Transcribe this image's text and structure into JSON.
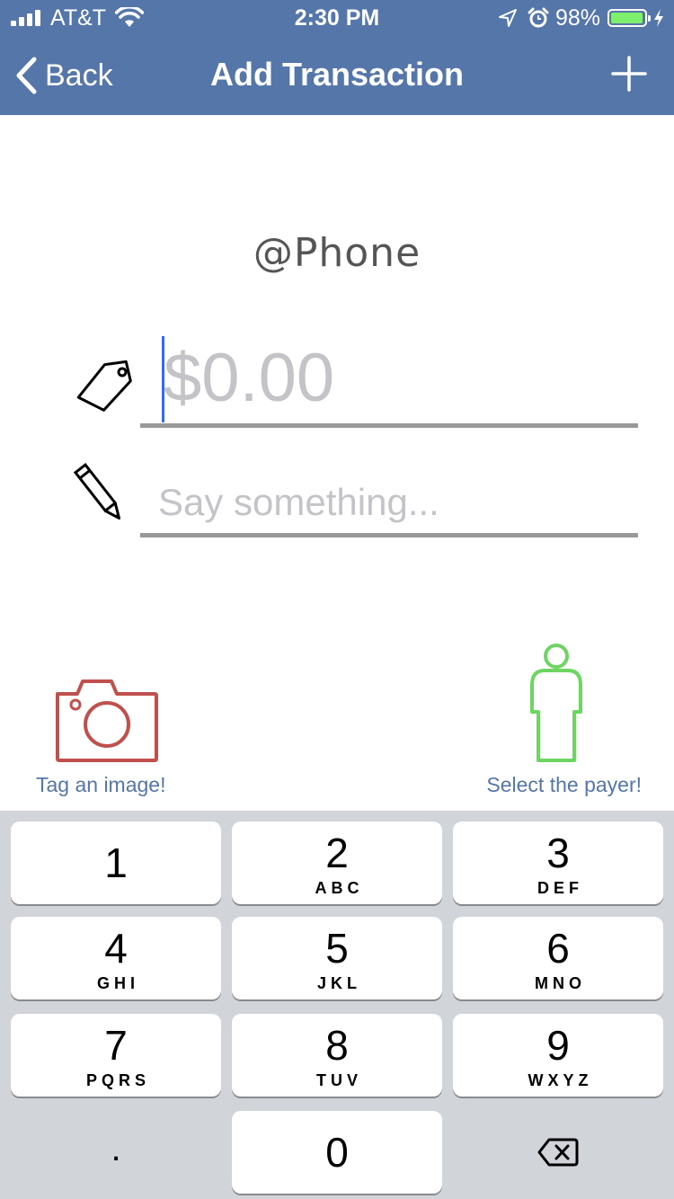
{
  "status_bar": {
    "carrier": "AT&T",
    "time": "2:30 PM",
    "battery": "98%",
    "battery_level": 0.98,
    "icons": [
      "signal-bars-icon",
      "wifi-icon",
      "location-arrow-icon",
      "alarm-icon",
      "battery-icon",
      "charging-bolt-icon"
    ]
  },
  "nav": {
    "back_label": "Back",
    "title": "Add Transaction",
    "add_icon": "plus-icon"
  },
  "main": {
    "title": "@Phone",
    "amount_placeholder": "$0.00",
    "amount_value": "",
    "note_placeholder": "Say something...",
    "note_value": "",
    "tag_image_label": "Tag an image!",
    "select_payer_label": "Select the payer!"
  },
  "colors": {
    "nav_bar": "#5476a9",
    "link": "#5476a9",
    "camera": "#c0504d",
    "payer": "#6dd662",
    "caret": "#3c69e6",
    "keypad_bg": "#d1d4d9"
  },
  "keypad": {
    "keys": [
      {
        "digit": "1",
        "letters": ""
      },
      {
        "digit": "2",
        "letters": "ABC"
      },
      {
        "digit": "3",
        "letters": "DEF"
      },
      {
        "digit": "4",
        "letters": "GHI"
      },
      {
        "digit": "5",
        "letters": "JKL"
      },
      {
        "digit": "6",
        "letters": "MNO"
      },
      {
        "digit": "7",
        "letters": "PQRS"
      },
      {
        "digit": "8",
        "letters": "TUV"
      },
      {
        "digit": "9",
        "letters": "WXYZ"
      },
      {
        "digit": ".",
        "letters": ""
      },
      {
        "digit": "0",
        "letters": ""
      }
    ],
    "delete_icon": "backspace-icon"
  }
}
